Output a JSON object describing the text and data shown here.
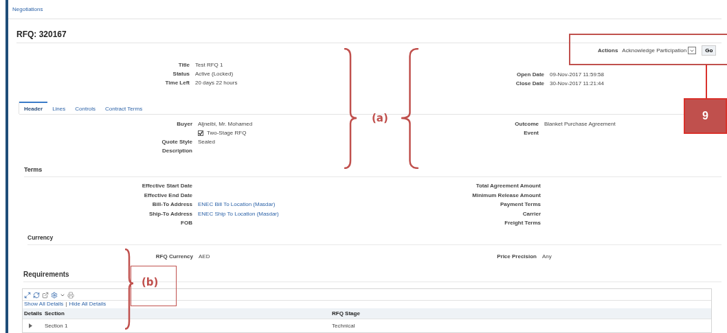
{
  "breadcrumb": "Negotiations",
  "title": "RFQ: 320167",
  "actions": {
    "label": "Actions",
    "value": "Acknowledge Participation",
    "button": "Go"
  },
  "summary": {
    "left": [
      {
        "kind": "text",
        "label": "Title",
        "value": "Test RFQ 1"
      },
      {
        "kind": "text",
        "label": "Status",
        "value": "Active (Locked)"
      },
      {
        "kind": "text",
        "label": "Time Left",
        "value": "20 days 22 hours"
      }
    ],
    "right": [
      {
        "kind": "text",
        "label": "Open Date",
        "value": "09-Nov-2017 11:59:58"
      },
      {
        "kind": "text",
        "label": "Close Date",
        "value": "30-Nov-2017 11:21:44"
      }
    ]
  },
  "tabs": [
    {
      "label": "Header",
      "selected": true
    },
    {
      "label": "Lines",
      "selected": false
    },
    {
      "label": "Controls",
      "selected": false
    },
    {
      "label": "Contract Terms",
      "selected": false
    }
  ],
  "header_fields": {
    "left": [
      {
        "kind": "text",
        "label": "Buyer",
        "value": "Aljneibi, Mr. Mohamed"
      },
      {
        "kind": "checkbox",
        "value": "Two-Stage RFQ",
        "checked": true
      },
      {
        "kind": "text",
        "label": "Quote Style",
        "value": "Sealed"
      },
      {
        "kind": "text",
        "label": "Description"
      }
    ],
    "right": [
      {
        "kind": "text",
        "label": "Outcome",
        "value": "Blanket Purchase Agreement"
      },
      {
        "kind": "text",
        "label": "Event"
      }
    ]
  },
  "terms": {
    "heading": "Terms",
    "left": [
      {
        "kind": "text",
        "label": "Effective Start Date"
      },
      {
        "kind": "text",
        "label": "Effective End Date"
      },
      {
        "kind": "link",
        "label": "Bill-To Address",
        "value": "ENEC Bill To Location (Masdar)"
      },
      {
        "kind": "link",
        "label": "Ship-To Address",
        "value": "ENEC Ship To Location (Masdar)"
      },
      {
        "kind": "text",
        "label": "FOB"
      }
    ],
    "right": [
      {
        "kind": "text",
        "label": "Total Agreement Amount"
      },
      {
        "kind": "text",
        "label": "Minimum Release Amount"
      },
      {
        "kind": "text",
        "label": "Payment Terms"
      },
      {
        "kind": "text",
        "label": "Carrier"
      },
      {
        "kind": "text",
        "label": "Freight Terms"
      }
    ]
  },
  "currency": {
    "heading": "Currency",
    "left": [
      {
        "kind": "text",
        "label": "RFQ Currency",
        "value": "AED"
      }
    ],
    "right": [
      {
        "kind": "text",
        "label": "Price Precision",
        "value": "Any"
      }
    ]
  },
  "requirements": {
    "heading": "Requirements",
    "links": [
      "Show All Details",
      "Hide All Details"
    ],
    "separator": "|",
    "columns": [
      "Details",
      "Section",
      "RFQ Stage"
    ],
    "rows": [
      {
        "expanded": false,
        "section": "Section 1",
        "rfq_stage": "Technical"
      }
    ]
  },
  "annotations": [
    {
      "kind": "brace-pair",
      "label": "(a)"
    },
    {
      "kind": "brace-box",
      "label": "(b)"
    },
    {
      "kind": "callout",
      "label": "9"
    }
  ]
}
